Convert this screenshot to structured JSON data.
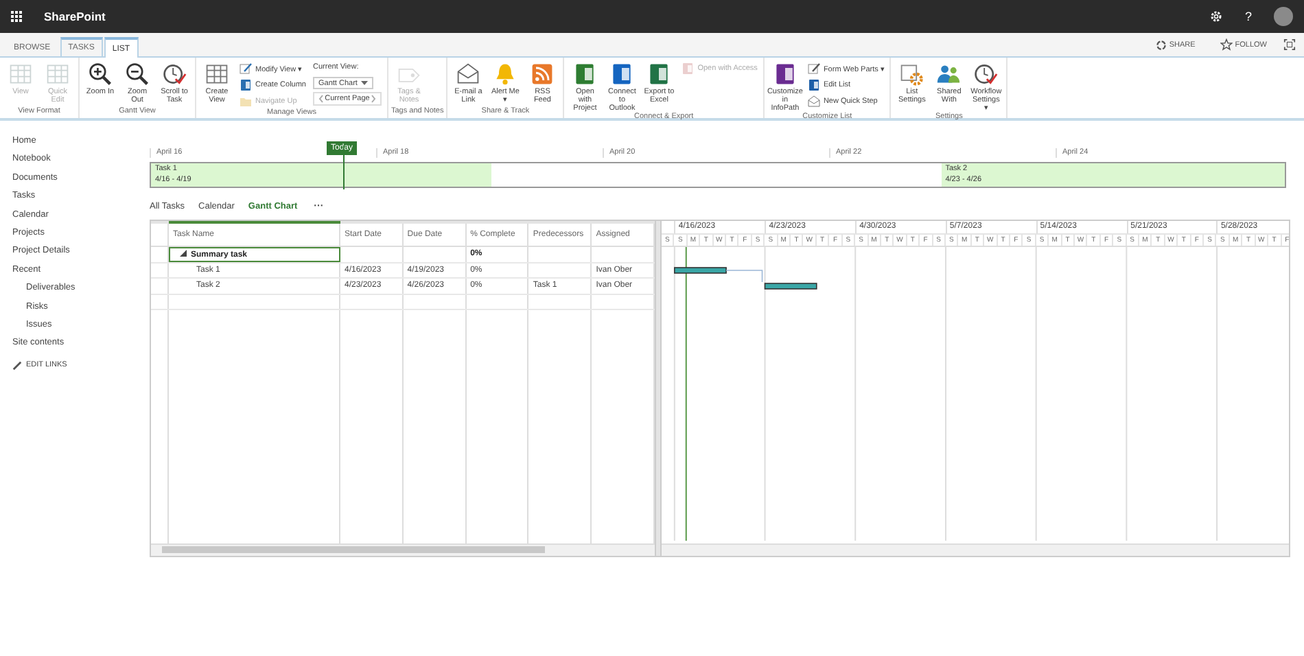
{
  "top_bar": {
    "app_name": "SharePoint",
    "help": "?"
  },
  "ribbon_tabs": [
    {
      "label": "BROWSE",
      "selected": false
    },
    {
      "label": "TASKS",
      "selected": false
    },
    {
      "label": "LIST",
      "selected": true
    }
  ],
  "header_actions": [
    {
      "label": "SHARE"
    },
    {
      "label": "FOLLOW"
    }
  ],
  "ribbon_groups": [
    {
      "label": "View Format",
      "items": [
        {
          "kind": "large",
          "label": "View",
          "disabled": true
        },
        {
          "kind": "large",
          "label": "Quick Edit",
          "disabled": true
        }
      ]
    },
    {
      "label": "Gantt View",
      "items": [
        {
          "kind": "large",
          "label": "Zoom In",
          "disabled": false
        },
        {
          "kind": "large",
          "label": "Zoom Out",
          "disabled": false
        },
        {
          "kind": "large",
          "label": "Scroll to Task",
          "disabled": false
        }
      ]
    },
    {
      "label": "Manage Views",
      "items": [
        {
          "kind": "large",
          "label": "Create View",
          "disabled": false
        },
        {
          "kind": "stack",
          "items": [
            {
              "kind": "small",
              "label": "Modify View ▾",
              "disabled": false
            },
            {
              "kind": "small",
              "label": "Create Column",
              "disabled": false
            },
            {
              "kind": "small",
              "label": "Navigate Up",
              "disabled": true
            }
          ]
        },
        {
          "kind": "stack",
          "items": [
            {
              "kind": "caption",
              "label": "Current View:"
            },
            {
              "kind": "dropdown",
              "value": "Gantt Chart"
            },
            {
              "kind": "pager",
              "label": "Current Page"
            }
          ]
        }
      ]
    },
    {
      "label": "Tags and Notes",
      "items": [
        {
          "kind": "large",
          "label": "Tags & Notes",
          "disabled": true
        }
      ]
    },
    {
      "label": "Share & Track",
      "items": [
        {
          "kind": "large",
          "label": "E-mail a Link",
          "disabled": false
        },
        {
          "kind": "large",
          "label": "Alert Me ▾",
          "disabled": false
        },
        {
          "kind": "large",
          "label": "RSS Feed",
          "disabled": false
        }
      ]
    },
    {
      "label": "Connect & Export",
      "items": [
        {
          "kind": "large",
          "label": "Open with Project",
          "disabled": false
        },
        {
          "kind": "large",
          "label": "Connect to Outlook",
          "disabled": false
        },
        {
          "kind": "large",
          "label": "Export to Excel",
          "disabled": false
        },
        {
          "kind": "stack",
          "items": [
            {
              "kind": "small",
              "label": "Open with Access",
              "disabled": true
            }
          ]
        }
      ]
    },
    {
      "label": "Customize List",
      "items": [
        {
          "kind": "large",
          "label": "Customize in InfoPath",
          "disabled": false
        },
        {
          "kind": "stack",
          "items": [
            {
              "kind": "small",
              "label": "Form Web Parts ▾",
              "disabled": false
            },
            {
              "kind": "small",
              "label": "Edit List",
              "disabled": false
            },
            {
              "kind": "small",
              "label": "New Quick Step",
              "disabled": false
            }
          ]
        }
      ]
    },
    {
      "label": "Settings",
      "items": [
        {
          "kind": "large",
          "label": "List Settings",
          "disabled": false
        },
        {
          "kind": "large",
          "label": "Shared With",
          "disabled": false
        },
        {
          "kind": "large",
          "label": "Workflow Settings ▾",
          "disabled": false
        }
      ]
    }
  ],
  "sidebar": {
    "items": [
      {
        "label": "Home"
      },
      {
        "label": "Notebook"
      },
      {
        "label": "Documents"
      },
      {
        "label": "Tasks"
      },
      {
        "label": "Calendar"
      },
      {
        "label": "Projects"
      },
      {
        "label": "Project Details"
      },
      {
        "label": "Recent",
        "children": [
          {
            "label": "Deliverables"
          },
          {
            "label": "Risks"
          },
          {
            "label": "Issues"
          }
        ]
      },
      {
        "label": "Site contents"
      }
    ],
    "edit_links": "EDIT LINKS"
  },
  "timeline": {
    "today": "Today",
    "dates": [
      "April 16",
      "April 18",
      "April 20",
      "April 22",
      "April 24"
    ],
    "tasks": [
      {
        "name": "Task 1",
        "dates": "4/16 - 4/19"
      },
      {
        "name": "Task 2",
        "dates": "4/23 - 4/26"
      }
    ]
  },
  "views": [
    {
      "label": "All Tasks",
      "selected": false
    },
    {
      "label": "Calendar",
      "selected": false
    },
    {
      "label": "Gantt Chart",
      "selected": true
    }
  ],
  "views_more": "···",
  "table": {
    "columns": [
      "Task Name",
      "Start Date",
      "Due Date",
      "% Complete",
      "Predecessors",
      "Assigned"
    ],
    "rows": [
      {
        "task_name": "Summary task",
        "percent_complete": "0%",
        "expanded": true,
        "selected": true,
        "children": [
          {
            "task_name": "Task 1",
            "start_date": "4/16/2023",
            "due_date": "4/19/2023",
            "percent_complete": "0%",
            "assigned": "Ivan Ober",
            "selected": false
          },
          {
            "task_name": "Task 2",
            "start_date": "4/23/2023",
            "due_date": "4/26/2023",
            "percent_complete": "0%",
            "predecessors": "Task 1",
            "assigned": "Ivan Ober",
            "selected": false
          }
        ]
      }
    ]
  },
  "gantt": {
    "weeks": [
      "4/16/2023",
      "4/23/2023",
      "4/30/2023",
      "5/7/2023",
      "5/14/2023",
      "5/21/2023",
      "5/28/2023"
    ],
    "days": [
      "S",
      "S",
      "M",
      "T",
      "W",
      "T",
      "F",
      "S",
      "S",
      "M",
      "T",
      "W",
      "T",
      "F",
      "S",
      "S",
      "M",
      "T",
      "W",
      "T",
      "F",
      "S",
      "S",
      "M",
      "T",
      "W",
      "T",
      "F",
      "S",
      "S",
      "M",
      "T",
      "W",
      "T",
      "F",
      "S",
      "S",
      "M",
      "T",
      "W",
      "T",
      "F",
      "S",
      "S",
      "M",
      "T",
      "W",
      "T",
      "F"
    ]
  }
}
